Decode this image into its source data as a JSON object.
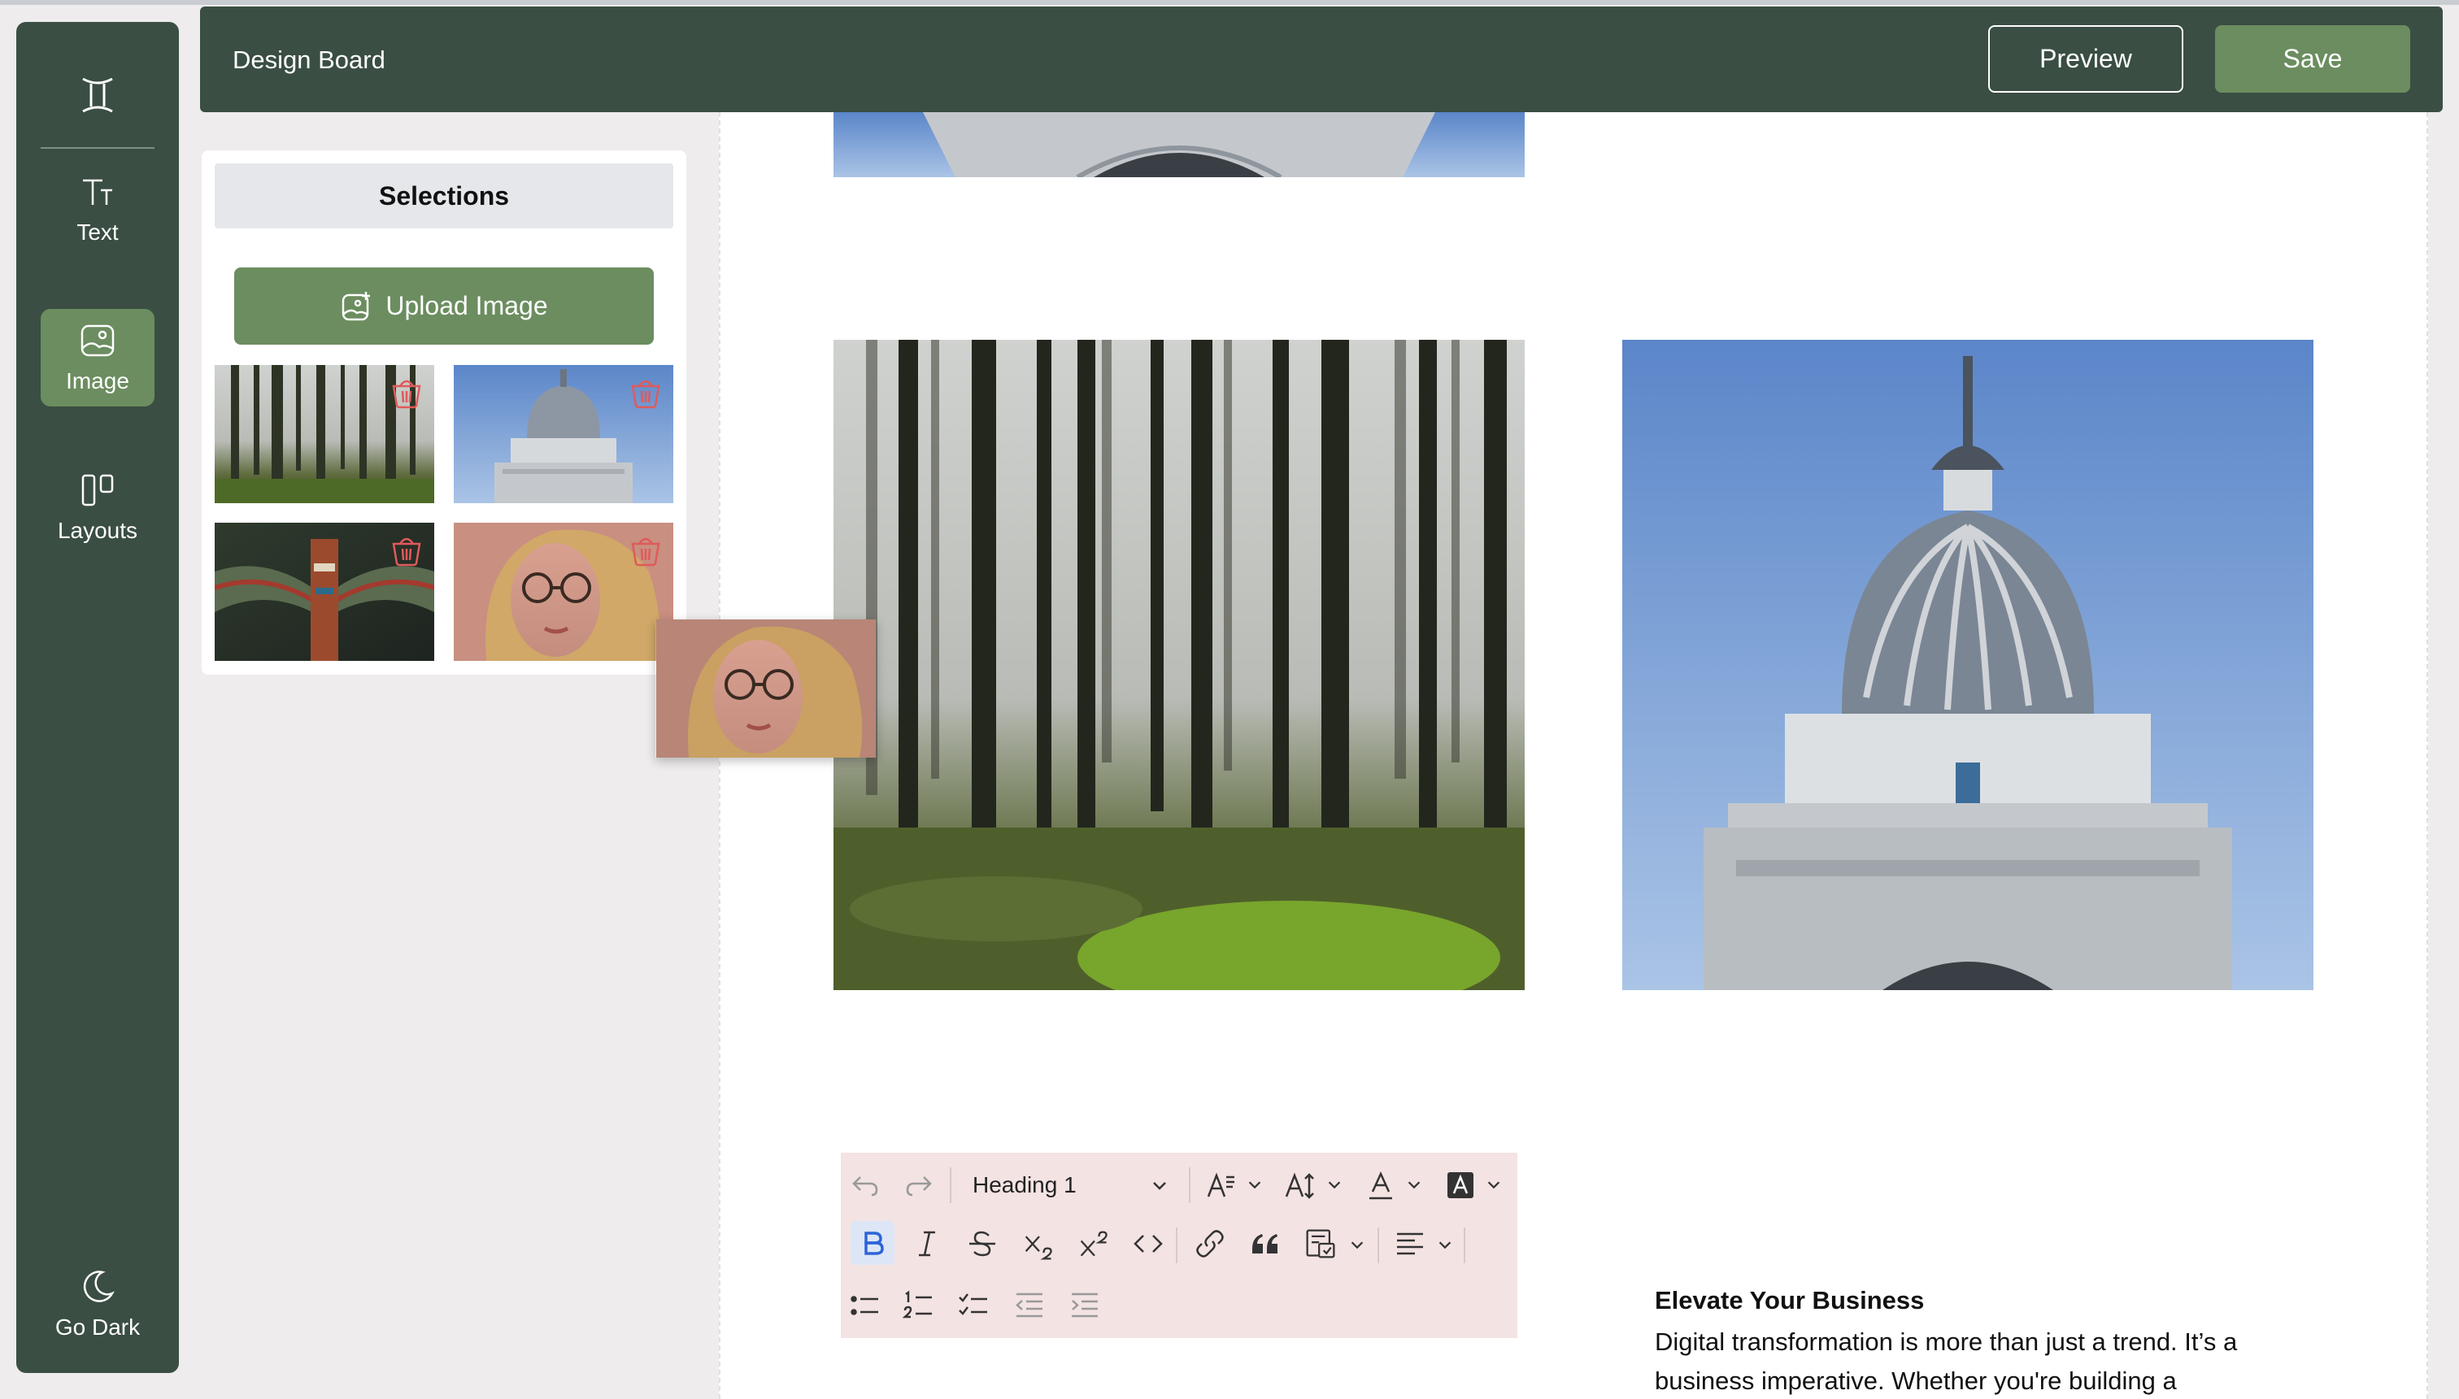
{
  "header": {
    "title": "Design Board",
    "preview_label": "Preview",
    "save_label": "Save"
  },
  "sidebar": {
    "items": [
      {
        "label": "Text",
        "icon": "text-icon"
      },
      {
        "label": "Image",
        "icon": "image-icon",
        "active": true
      },
      {
        "label": "Layouts",
        "icon": "layouts-icon"
      }
    ],
    "bottom": {
      "label": "Go Dark",
      "icon": "moon-icon"
    }
  },
  "panel": {
    "title": "Selections",
    "upload_label": "Upload Image",
    "images": [
      {
        "name": "forest",
        "deletable": true
      },
      {
        "name": "dome",
        "deletable": true
      },
      {
        "name": "totem",
        "deletable": true
      },
      {
        "name": "woman-glasses",
        "deletable": true
      }
    ]
  },
  "editor": {
    "block_style": "Heading 1",
    "toolbar_row1": [
      "undo-icon",
      "redo-icon",
      "font-family-icon",
      "font-size-icon",
      "font-color-icon",
      "highlight-color-icon"
    ],
    "toolbar_row2": [
      "bold-icon",
      "italic-icon",
      "strikethrough-icon",
      "subscript-icon",
      "superscript-icon",
      "code-icon",
      "link-icon",
      "quote-icon",
      "insert-template-icon",
      "align-icon"
    ],
    "toolbar_row3": [
      "bullet-list-icon",
      "numbered-list-icon",
      "todo-list-icon",
      "outdent-icon",
      "indent-icon"
    ]
  },
  "content": {
    "heading": "Elevate Your Business",
    "body_line1": "Digital transformation is more than just a trend. It’s a",
    "body_line2": "business imperative. Whether you're building a"
  },
  "colors": {
    "sidebar_bg": "#3a4e43",
    "accent_green": "#6b8d5f",
    "toolbar_bg": "#f4e3e3",
    "delete_red": "#e05a5a"
  }
}
